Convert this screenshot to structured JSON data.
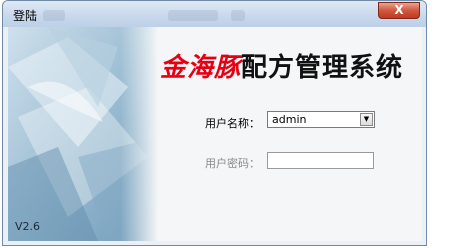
{
  "window": {
    "title": "登陆",
    "close_glyph": "X"
  },
  "app": {
    "brand": "金海豚",
    "title_rest": "配方管理系统",
    "version": "V2.6",
    "brand_color": "#e60012"
  },
  "form": {
    "username_label": "用户名称：",
    "username_value": "admin",
    "password_label": "用户密码：",
    "password_value": "",
    "dropdown_glyph": "▼"
  },
  "icons": [
    "close-icon",
    "chevron-down-icon"
  ]
}
